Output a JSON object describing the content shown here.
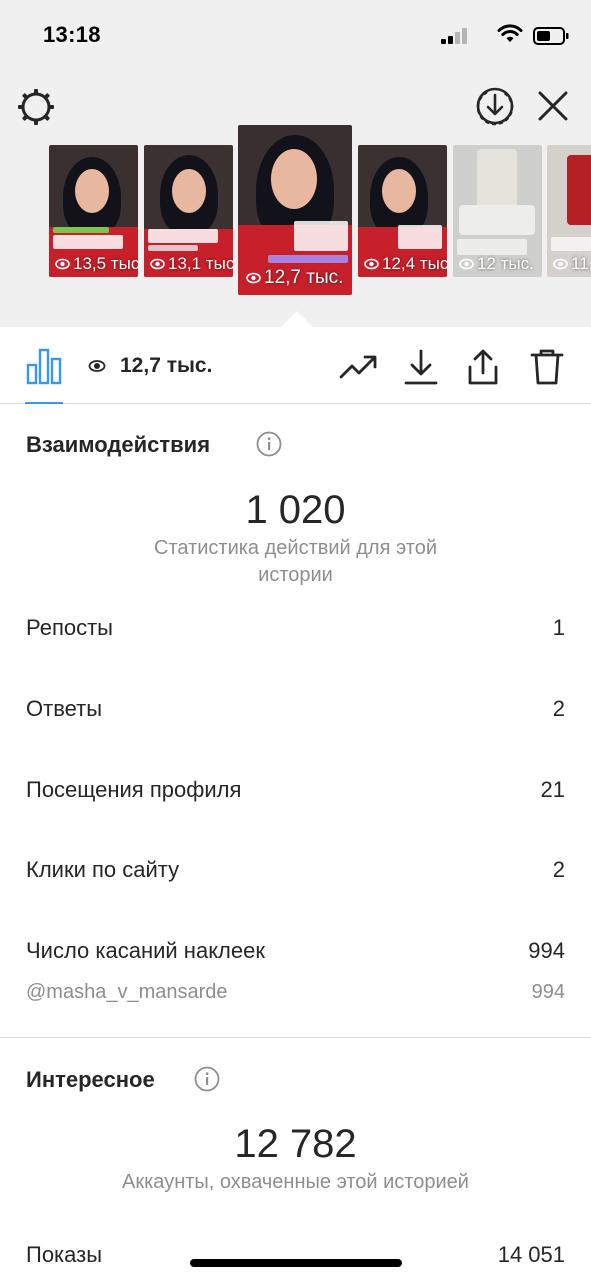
{
  "status_bar": {
    "time": "13:18"
  },
  "stories": [
    {
      "views": "13,5 тыс.",
      "kind": "portrait"
    },
    {
      "views": "13,1 тыс.",
      "kind": "portrait"
    },
    {
      "views": "12,7 тыс.",
      "kind": "portrait",
      "active": true
    },
    {
      "views": "12,4 тыс.",
      "kind": "portrait"
    },
    {
      "views": "12 тыс.",
      "kind": "machine"
    },
    {
      "views": "11,",
      "kind": "machine"
    }
  ],
  "toolbar": {
    "views_count": "12,7 тыс."
  },
  "interactions": {
    "title": "Взаимодействия",
    "total": "1 020",
    "subtitle": "Статистика действий для этой истории",
    "rows": [
      {
        "label": "Репосты",
        "value": "1"
      },
      {
        "label": "Ответы",
        "value": "2"
      },
      {
        "label": "Посещения профиля",
        "value": "21"
      },
      {
        "label": "Клики по сайту",
        "value": "2"
      },
      {
        "label": "Число касаний наклеек",
        "value": "994"
      }
    ],
    "sticker_sub": {
      "label": "@masha_v_mansarde",
      "value": "994"
    }
  },
  "discovery": {
    "title": "Интересное",
    "total": "12 782",
    "subtitle": "Аккаунты, охваченные этой историей",
    "rows": [
      {
        "label": "Показы",
        "value": "14 051"
      }
    ]
  },
  "colors": {
    "accent": "#3897f0",
    "text": "#262626",
    "secondary": "#8e8e8e",
    "header_bg": "#f0f0f0"
  },
  "icons": {
    "settings": "gear-icon",
    "download_all": "download-circle-icon",
    "close": "close-icon",
    "insights": "bar-chart-icon",
    "views": "eye-icon",
    "promote": "trend-icon",
    "save": "download-icon",
    "share": "share-icon",
    "delete": "trash-icon",
    "info": "info-icon"
  }
}
